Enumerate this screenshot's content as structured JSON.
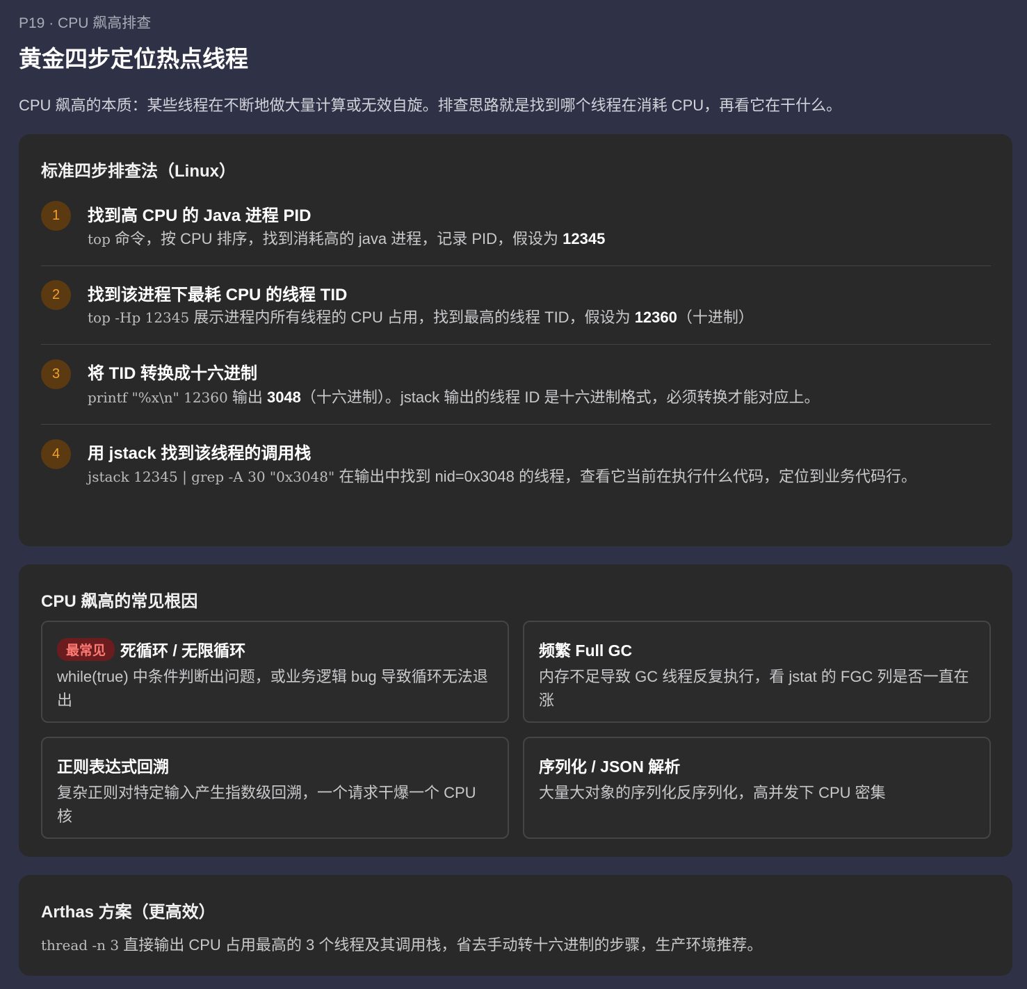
{
  "header": {
    "kicker": "P19 · CPU 飙高排查",
    "title": "黄金四步定位热点线程",
    "intro": "CPU 飙高的本质：某些线程在不断地做大量计算或无效自旋。排查思路就是找到哪个线程在消耗 CPU，再看它在干什么。"
  },
  "steps_card": {
    "title": "标准四步排查法（Linux）",
    "steps": [
      {
        "num": "1",
        "title": "找到高 CPU 的 Java 进程 PID",
        "code": "top",
        "text": " 命令，按 CPU 排序，找到消耗高的 java 进程，记录 PID，假设为 ",
        "bold": "12345",
        "tail": ""
      },
      {
        "num": "2",
        "title": "找到该进程下最耗 CPU 的线程 TID",
        "code": "top -Hp 12345",
        "text": " 展示进程内所有线程的 CPU 占用，找到最高的线程 TID，假设为 ",
        "bold": "12360",
        "tail": "（十进制）"
      },
      {
        "num": "3",
        "title": "将 TID 转换成十六进制",
        "code": "printf \"%x\\n\" 12360",
        "text": " 输出 ",
        "bold": "3048",
        "tail": "（十六进制）。jstack 输出的线程 ID 是十六进制格式，必须转换才能对应上。"
      },
      {
        "num": "4",
        "title": "用 jstack 找到该线程的调用栈",
        "code": "jstack 12345 | grep -A 30 \"0x3048\"",
        "text": " 在输出中找到 nid=0x3048 的线程，查看它当前在执行什么代码，定位到业务代码行。",
        "bold": "",
        "tail": ""
      }
    ]
  },
  "causes_card": {
    "title": "CPU 飙高的常见根因",
    "items": [
      {
        "badge": "最常见",
        "title": "死循环 / 无限循环",
        "desc": "while(true) 中条件判断出问题，或业务逻辑 bug 导致循环无法退出"
      },
      {
        "badge": "",
        "title": "频繁 Full GC",
        "desc": "内存不足导致 GC 线程反复执行，看 jstat 的 FGC 列是否一直在涨"
      },
      {
        "badge": "",
        "title": "正则表达式回溯",
        "desc": "复杂正则对特定输入产生指数级回溯，一个请求干爆一个 CPU 核"
      },
      {
        "badge": "",
        "title": "序列化 / JSON 解析",
        "desc": "大量大对象的序列化反序列化，高并发下 CPU 密集"
      }
    ]
  },
  "arthas_card": {
    "title": "Arthas 方案（更高效）",
    "code": "thread -n 3",
    "text": " 直接输出 CPU 占用最高的 3 个线程及其调用栈，省去手动转十六进制的步骤，生产环境推荐。"
  },
  "colors": {
    "page_bg": "#2f3246",
    "card_bg": "#292929",
    "step_badge_bg": "#5b3a12",
    "step_badge_fg": "#f0a030",
    "tag_bg": "#6a1c1f",
    "tag_fg": "#ff7a73"
  }
}
